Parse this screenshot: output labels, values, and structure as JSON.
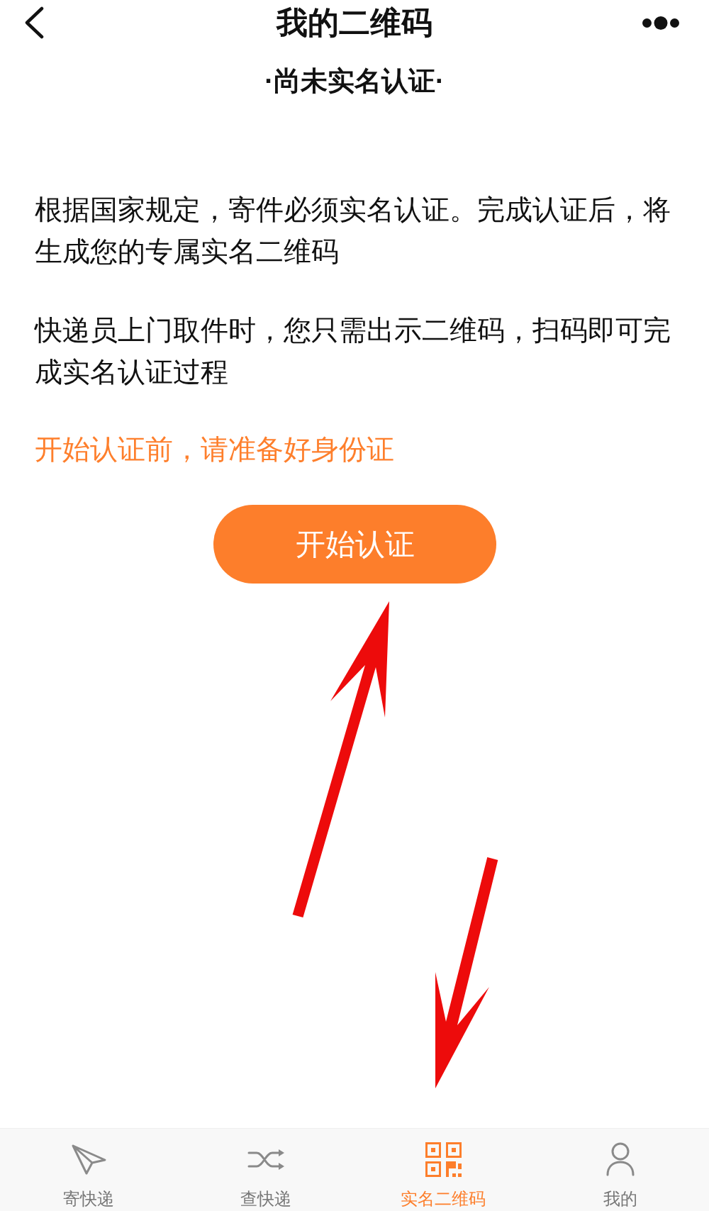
{
  "header": {
    "title": "我的二维码"
  },
  "status": "·尚未实名认证·",
  "paragraphs": [
    "根据国家规定，寄件必须实名认证。完成认证后，将生成您的专属实名二维码",
    "快递员上门取件时，您只需出示二维码，扫码即可完成实名认证过程"
  ],
  "notice": "开始认证前，请准备好身份证",
  "primary_button": {
    "label": "开始认证"
  },
  "tab_bar": {
    "tabs": [
      {
        "label": "寄快递",
        "selected": false
      },
      {
        "label": "查快递",
        "selected": false
      },
      {
        "label": "实名二维码",
        "selected": true
      },
      {
        "label": "我的",
        "selected": false
      }
    ]
  }
}
